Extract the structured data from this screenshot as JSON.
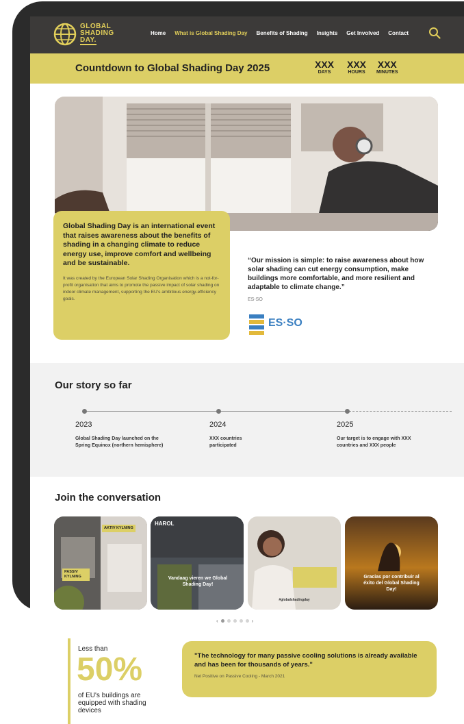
{
  "nav": {
    "logo_lines": [
      "GLOBAL",
      "SHADING",
      "DAY."
    ],
    "items": [
      "Home",
      "What is Global Shading Day",
      "Benefits of Shading",
      "Insights",
      "Get Involved",
      "Contact"
    ]
  },
  "countdown": {
    "title": "Countdown to Global Shading Day 2025",
    "units": [
      {
        "value": "XXX",
        "label": "DAYS"
      },
      {
        "value": "XXX",
        "label": "HOURS"
      },
      {
        "value": "XXX",
        "label": "MINUTES"
      }
    ]
  },
  "hero": {
    "card_title": "Global Shading Day is an international event that raises awareness about the benefits of shading in a changing climate to reduce energy use, improve comfort and wellbeing and be sustainable.",
    "card_body": "It was created by the European Solar Shading Organisation which is a not-for-profit organisation that aims to promote the passive impact of solar shading on indoor climate management, supporting the EU's ambitious energy-efficiency goals.",
    "mission_quote": "“Our mission is simple: to raise awareness about how solar shading can cut energy consumption, make buildings more comfortable,  and more resilient and adaptable to climate change.”",
    "mission_source": "ES-SO",
    "esso_logo_text": "ES·SO"
  },
  "story": {
    "title": "Our story so far",
    "milestones": [
      {
        "year": "2023",
        "text": "Global Shading Day launched on the Spring Equinox (northern hemisphere)"
      },
      {
        "year": "2024",
        "text": "XXX countries participated"
      },
      {
        "year": "2025",
        "text": "Our target is to engage with XXX countries and XXX people"
      }
    ]
  },
  "conversation": {
    "title": "Join the conversation",
    "posts": [
      {
        "badge_a": "AKTIV KYLNING",
        "badge_b": "PASSIV KYLNING"
      },
      {
        "brand": "HAROL",
        "caption": "Vandaag vieren we Global Shading Day!"
      },
      {
        "caption": "#globalshadingday"
      },
      {
        "caption": "Gracias por contribuir al éxito del Global Shading Day!"
      }
    ],
    "pager_prev": "‹",
    "pager_next": "›"
  },
  "stats": {
    "pre": "Less than",
    "big": "50%",
    "post": "of EU's buildings are equipped with shading devices"
  },
  "quote2": {
    "text": "\"The technology for many passive cooling solutions is already available and has been for thousands of years.\"",
    "source": "Net Positive on Passive Cooling - March 2021"
  },
  "colors": {
    "accent": "#dccf66",
    "nav_bg": "#3c3a39",
    "story_bg": "#f2f2f2"
  }
}
